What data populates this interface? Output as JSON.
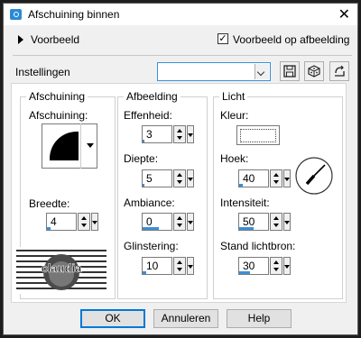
{
  "window": {
    "title": "Afschuining binnen",
    "close_symbol": "✕"
  },
  "preview": {
    "toggle_label": "Voorbeeld",
    "checkbox_label": "Voorbeeld op afbeelding",
    "checkbox_checked": true,
    "check_mark": "✓"
  },
  "settings": {
    "label": "Instellingen",
    "value": "",
    "icons": [
      "save-icon",
      "dice-icon",
      "reset-icon"
    ]
  },
  "groups": {
    "afschuining": {
      "title": "Afschuining",
      "shape_label": "Afschuining:",
      "width_label": "Breedte:",
      "width_value": "4"
    },
    "afbeelding": {
      "title": "Afbeelding",
      "fields": [
        {
          "label": "Effenheid:",
          "value": "3"
        },
        {
          "label": "Diepte:",
          "value": "5"
        },
        {
          "label": "Ambiance:",
          "value": "0"
        },
        {
          "label": "Glinstering:",
          "value": "10"
        }
      ]
    },
    "licht": {
      "title": "Licht",
      "color_label": "Kleur:",
      "color_value": "#ffffff",
      "fields": [
        {
          "label": "Hoek:",
          "value": "40"
        },
        {
          "label": "Intensiteit:",
          "value": "50"
        },
        {
          "label": "Stand lichtbron:",
          "value": "30"
        }
      ]
    }
  },
  "watermark": {
    "text": "claudia"
  },
  "buttons": {
    "ok": "OK",
    "cancel": "Annuleren",
    "help": "Help"
  }
}
